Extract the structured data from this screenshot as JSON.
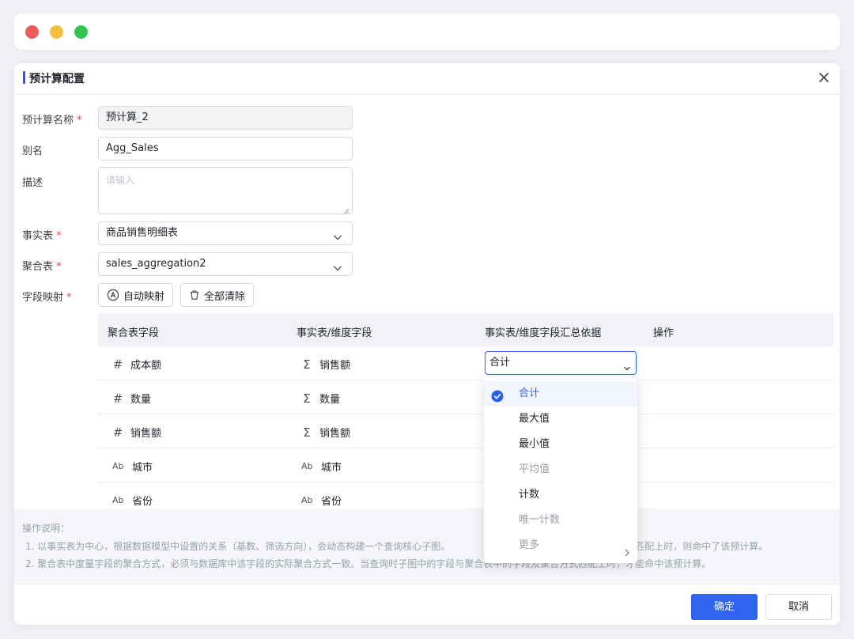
{
  "window": {
    "buttons": [
      "close",
      "minimize",
      "maximize"
    ]
  },
  "dialog": {
    "title": "预计算配置",
    "form": {
      "name_label": "预计算名称",
      "name_value": "预计算_2",
      "alias_label": "别名",
      "alias_value": "Agg_Sales",
      "desc_label": "描述",
      "desc_placeholder": "请输入",
      "fact_label": "事实表",
      "fact_value": "商品销售明细表",
      "agg_label": "聚合表",
      "agg_value": "sales_aggregation2",
      "mapping_label": "字段映射",
      "required_mark": "*"
    },
    "buttons": {
      "auto_map": "自动映射",
      "clear_all": "全部清除",
      "ok": "确定",
      "cancel": "取消"
    },
    "table": {
      "columns": [
        "聚合表字段",
        "事实表/维度字段",
        "事实表/维度字段汇总依据",
        "操作"
      ],
      "rows": [
        {
          "agg_field": "成本额",
          "agg_icon": "#",
          "fact_field": "销售额",
          "fact_icon": "Σ",
          "basis": "合计"
        },
        {
          "agg_field": "数量",
          "agg_icon": "#",
          "fact_field": "数量",
          "fact_icon": "Σ",
          "basis": ""
        },
        {
          "agg_field": "销售额",
          "agg_icon": "#",
          "fact_field": "销售额",
          "fact_icon": "Σ",
          "basis": ""
        },
        {
          "agg_field": "城市",
          "agg_icon": "Ab",
          "fact_field": "城市",
          "fact_icon": "Ab",
          "basis": ""
        },
        {
          "agg_field": "省份",
          "agg_icon": "Ab",
          "fact_field": "省份",
          "fact_icon": "Ab",
          "basis": ""
        }
      ]
    },
    "dropdown": {
      "selected": "合计",
      "options": [
        "合计",
        "最大值",
        "最小值",
        "平均值",
        "计数",
        "唯一计数",
        "更多"
      ]
    },
    "notes": {
      "title": "操作说明：",
      "line1_left": "1. 以事实表为中心，根据数据模型中设置的关系（基数、筛选方向），会动态构建一个查询核心子图。",
      "line1_right": "的字段匹配上时，则命中了该预计算。",
      "line2": "2. 聚合表中度量字段的聚合方式，必须与数据库中该字段的实际聚合方式一致。当查询时子图中的字段与聚合表中的字段及聚合方式匹配上时，才能命中该预计算。"
    }
  },
  "colors": {
    "accent": "#2f64f0",
    "required": "#e5484d",
    "close_dot": "#ee5b5b",
    "min_dot": "#f4bf3a",
    "max_dot": "#35c454"
  }
}
